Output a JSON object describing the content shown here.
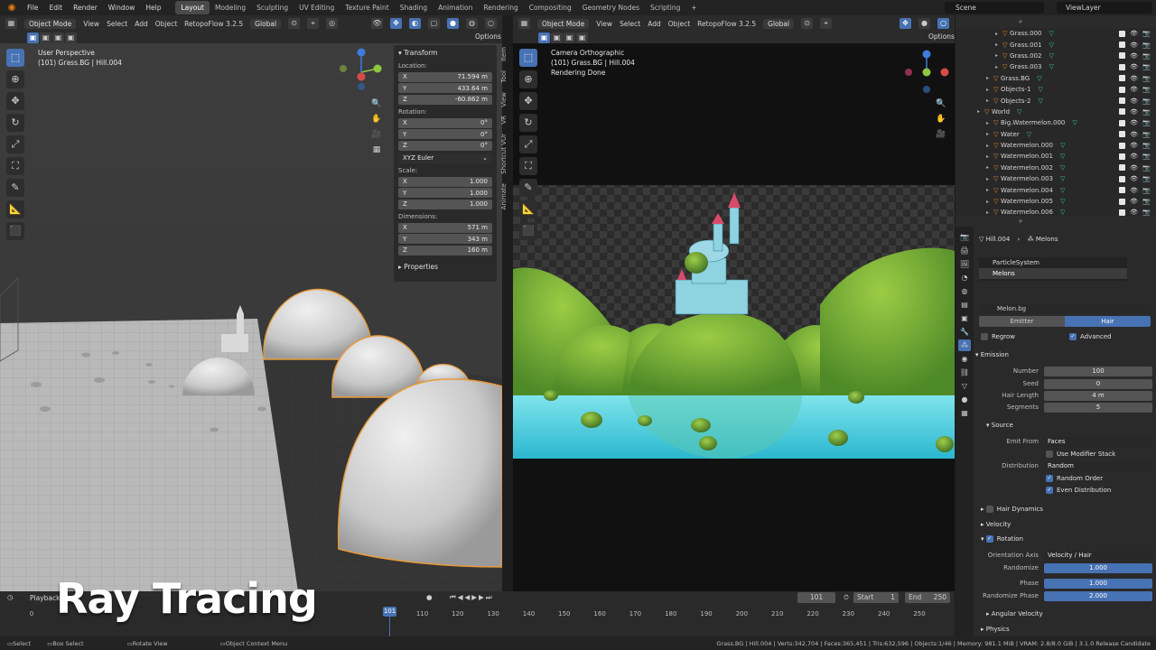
{
  "menu": [
    "File",
    "Edit",
    "Render",
    "Window",
    "Help"
  ],
  "workspaces": [
    "Layout",
    "Modeling",
    "Sculpting",
    "UV Editing",
    "Texture Paint",
    "Shading",
    "Animation",
    "Rendering",
    "Compositing",
    "Geometry Nodes",
    "Scripting"
  ],
  "scene_label": "Scene",
  "viewlayer_label": "ViewLayer",
  "left_header": {
    "mode": "Object Mode",
    "items": [
      "View",
      "Select",
      "Add",
      "Object"
    ],
    "addon": "RetopoFlow 3.2.5",
    "orientation": "Global"
  },
  "right_header": {
    "mode": "Object Mode",
    "items": [
      "View",
      "Select",
      "Add",
      "Object"
    ],
    "addon": "RetopoFlow 3.2.5",
    "orientation": "Global"
  },
  "options_label": "Options",
  "viewport_left": {
    "line1": "User Perspective",
    "line2": "(101) Grass.BG | Hill.004"
  },
  "viewport_right": {
    "line1": "Camera Orthographic",
    "line2": "(101) Grass.BG | Hill.004",
    "line3": "Rendering Done"
  },
  "transform": {
    "header": "Transform",
    "location_label": "Location:",
    "location": [
      {
        "axis": "X",
        "value": "71.594 m"
      },
      {
        "axis": "Y",
        "value": "433.64 m"
      },
      {
        "axis": "Z",
        "value": "-60.862 m"
      }
    ],
    "rotation_label": "Rotation:",
    "rotation": [
      {
        "axis": "X",
        "value": "0°"
      },
      {
        "axis": "Y",
        "value": "0°"
      },
      {
        "axis": "Z",
        "value": "0°"
      }
    ],
    "rotation_mode": "XYZ Euler",
    "scale_label": "Scale:",
    "scale": [
      {
        "axis": "X",
        "value": "1.000"
      },
      {
        "axis": "Y",
        "value": "1.000"
      },
      {
        "axis": "Z",
        "value": "1.000"
      }
    ],
    "dimensions_label": "Dimensions:",
    "dimensions": [
      {
        "axis": "X",
        "value": "571 m"
      },
      {
        "axis": "Y",
        "value": "343 m"
      },
      {
        "axis": "Z",
        "value": "160 m"
      }
    ],
    "properties_label": "Properties"
  },
  "side_tabs": [
    "Item",
    "Tool",
    "View",
    "VR",
    "Shortcut VUr",
    "Animate"
  ],
  "outliner": [
    {
      "name": "Grass.000",
      "indent": 3
    },
    {
      "name": "Grass.001",
      "indent": 3
    },
    {
      "name": "Grass.002",
      "indent": 3
    },
    {
      "name": "Grass.003",
      "indent": 3
    },
    {
      "name": "Grass.BG",
      "indent": 2
    },
    {
      "name": "Objects-1",
      "indent": 2
    },
    {
      "name": "Objects-2",
      "indent": 2
    },
    {
      "name": "World",
      "indent": 1
    },
    {
      "name": "Big.Watermelon.000",
      "indent": 2
    },
    {
      "name": "Water",
      "indent": 2
    },
    {
      "name": "Watermelon.000",
      "indent": 2
    },
    {
      "name": "Watermelon.001",
      "indent": 2
    },
    {
      "name": "Watermelon.002",
      "indent": 2
    },
    {
      "name": "Watermelon.003",
      "indent": 2
    },
    {
      "name": "Watermelon.004",
      "indent": 2
    },
    {
      "name": "Watermelon.005",
      "indent": 2
    },
    {
      "name": "Watermelon.006",
      "indent": 2
    }
  ],
  "properties": {
    "breadcrumb_object": "Hill.004",
    "breadcrumb_system": "Melons",
    "particle_slots": [
      "ParticleSystem",
      "Melons"
    ],
    "settings_name": "Melon.bg",
    "type_emitter": "Emitter",
    "type_hair": "Hair",
    "regrow": "Regrow",
    "advanced": "Advanced",
    "emission_label": "Emission",
    "number_label": "Number",
    "number": "100",
    "seed_label": "Seed",
    "seed": "0",
    "hair_length_label": "Hair Length",
    "hair_length": "4 m",
    "segments_label": "Segments",
    "segments": "5",
    "source_label": "Source",
    "emit_from_label": "Emit From",
    "emit_from": "Faces",
    "use_modifier_stack": "Use Modifier Stack",
    "distribution_label": "Distribution",
    "distribution": "Random",
    "random_order": "Random Order",
    "even_distribution": "Even Distribution",
    "hair_dynamics": "Hair Dynamics",
    "velocity": "Velocity",
    "rotation": "Rotation",
    "orientation_axis_label": "Orientation Axis",
    "orientation_axis": "Velocity / Hair",
    "randomize_label": "Randomize",
    "randomize": "1.000",
    "phase_label": "Phase",
    "phase": "1.000",
    "randomize_phase_label": "Randomize Phase",
    "randomize_phase": "2.000",
    "angular_velocity": "Angular Velocity",
    "physics": "Physics"
  },
  "timeline": {
    "playback": "Playback",
    "current_frame": "101",
    "start_label": "Start",
    "start": "1",
    "end_label": "End",
    "end": "250",
    "ticks": [
      "0",
      "101",
      "110",
      "120",
      "130",
      "140",
      "150",
      "160",
      "170",
      "180",
      "190",
      "200",
      "210",
      "220",
      "230",
      "240",
      "250"
    ]
  },
  "overlay_title": "Ray Tracing",
  "status": {
    "select": "Select",
    "box_select": "Box Select",
    "rotate_view": "Rotate View",
    "context_menu": "Object Context Menu",
    "stats": "Grass.BG | Hill.004 | Verts:342,704 | Faces:365,451 | Tris:632,596 | Objects:1/46 | Memory: 981.1 MiB | VRAM: 2.8/8.0 GiB | 3.1.0 Release Candidate"
  },
  "colors": {
    "accent": "#4772b3",
    "selection": "#e89b3b",
    "water": "#35c8d8",
    "grass": "#7fb33a"
  }
}
